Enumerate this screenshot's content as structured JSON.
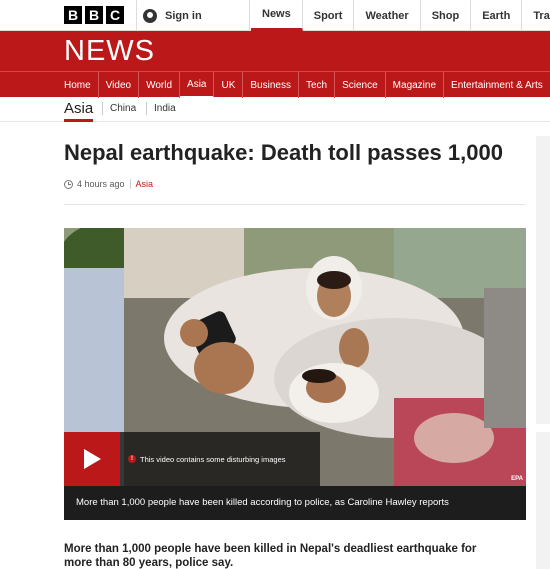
{
  "header": {
    "logo_letters": [
      "B",
      "B",
      "C"
    ],
    "signin_label": "Sign in",
    "nav": [
      "News",
      "Sport",
      "Weather",
      "Shop",
      "Earth",
      "Travel"
    ],
    "active_nav": "News"
  },
  "banner": {
    "title": "NEWS",
    "color": "#bb1919"
  },
  "section_nav": {
    "items": [
      "Home",
      "Video",
      "World",
      "Asia",
      "UK",
      "Business",
      "Tech",
      "Science",
      "Magazine",
      "Entertainment & Arts"
    ],
    "active": "Asia"
  },
  "sub_nav": {
    "title": "Asia",
    "items": [
      "China",
      "India"
    ]
  },
  "article": {
    "headline": "Nepal earthquake: Death toll passes 1,000",
    "time": "4 hours ago",
    "tag": "Asia",
    "media": {
      "warning": "This video contains some disturbing images",
      "credit": "EPA",
      "caption": "More than 1,000 people have been killed according to police, as Caroline Hawley reports"
    },
    "lede": "More than 1,000 people have been killed in Nepal's deadliest earthquake for more than 80 years, police say."
  }
}
